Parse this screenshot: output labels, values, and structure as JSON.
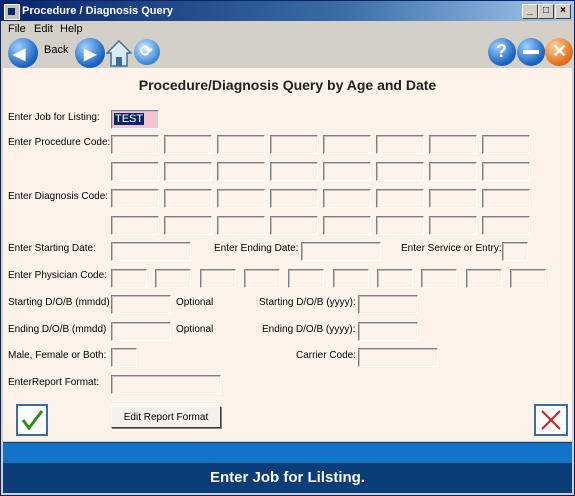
{
  "window": {
    "title": "Procedure / Diagnosis Query",
    "min_label": "_",
    "max_label": "□",
    "close_label": "×"
  },
  "menu": [
    "File",
    "Edit",
    "Help"
  ],
  "toolbar": {
    "back_label": "Back"
  },
  "heading": "Procedure/Diagnosis Query by Age and Date",
  "labels": {
    "job": "Enter Job for Listing:",
    "procedure": "Enter Procedure Code:",
    "diagnosis": "Enter Diagnosis Code:",
    "start_date": "Enter Starting Date:",
    "end_date": "Enter Ending Date:",
    "service": "Enter Service or Entry:",
    "physician": "Enter Physician Code:",
    "start_dob_mmdd": "Starting D/O/B (mmdd)",
    "optional1": "Optional",
    "start_dob_yyyy": "Starting D/O/B (yyyy):",
    "end_dob_mmdd": "Ending D/O/B (mmdd)",
    "optional2": "Optional",
    "end_dob_yyyy": "Ending D/O/B (yyyy):",
    "sex": "Male, Female or Both:",
    "carrier": "Carrier Code:",
    "report_format": "EnterReport Format:"
  },
  "fields": {
    "job_value": "TEST"
  },
  "buttons": {
    "edit_report": "Edit Report Format"
  },
  "status": {
    "message": "Enter Job for Lilsting."
  },
  "colors": {
    "accent": "#1273c7",
    "status_dark": "#0b3d78",
    "form_bg": "#fdf3eb",
    "highlight": "#0a246a"
  }
}
